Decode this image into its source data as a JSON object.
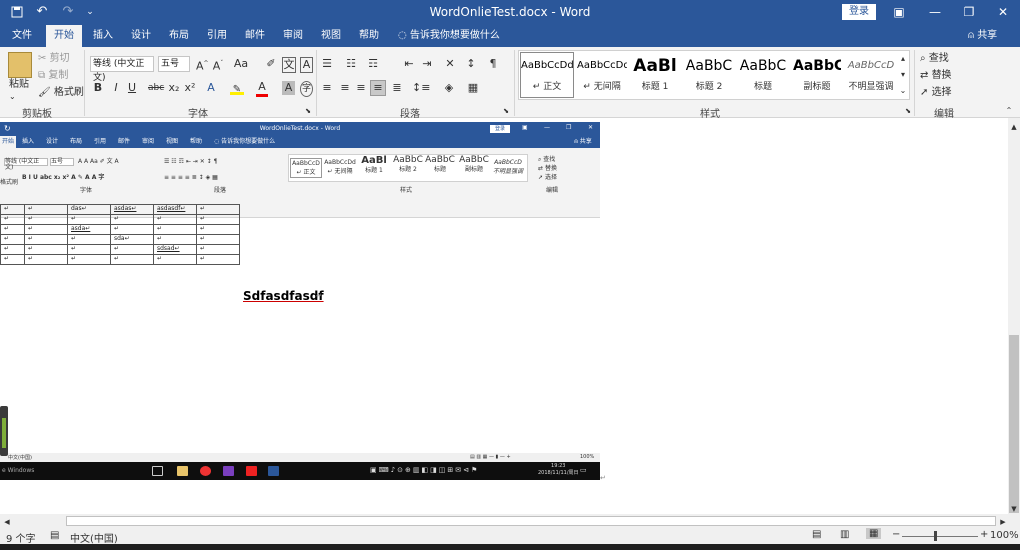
{
  "titlebar": {
    "title": "WordOnlieTest.docx - Word",
    "login": "登录",
    "undo": "↶",
    "redo": "↷",
    "save_icon": "floppy-icon"
  },
  "tabs": [
    "文件",
    "开始",
    "插入",
    "设计",
    "布局",
    "引用",
    "邮件",
    "审阅",
    "视图",
    "帮助"
  ],
  "tell_me": "告诉我你想要做什么",
  "share": "共享",
  "clipboard": {
    "paste": "粘贴",
    "cut": "剪切",
    "copy": "复制",
    "format_painter": "格式刷",
    "group": "剪贴板"
  },
  "font": {
    "name": "等线 (中文正文)",
    "size": "五号",
    "group": "字体"
  },
  "paragraph": {
    "group": "段落"
  },
  "styles": {
    "group": "样式",
    "items": [
      {
        "preview": "AaBbCcDd",
        "label": "↵ 正文"
      },
      {
        "preview": "AaBbCcDd",
        "label": "↵ 无间隔"
      },
      {
        "preview": "AaBl",
        "label": "标题 1"
      },
      {
        "preview": "AaBbC",
        "label": "标题 2"
      },
      {
        "preview": "AaBbC",
        "label": "标题"
      },
      {
        "preview": "AaBbC",
        "label": "副标题"
      },
      {
        "preview": "AaBbCcD",
        "label": "不明显强调"
      }
    ]
  },
  "editing": {
    "find": "查找",
    "replace": "替换",
    "select": "选择",
    "group": "编辑"
  },
  "document": {
    "heading": "Sdfasdfasdf",
    "embedded": {
      "title": "WordOnlieTest.docx - Word",
      "login": "登录",
      "tell_me": "告诉我你想要做什么",
      "share": "共享",
      "tabs": [
        "开始",
        "插入",
        "设计",
        "布局",
        "引用",
        "邮件",
        "审阅",
        "视图",
        "帮助"
      ],
      "font_name": "等线 (中文正文)",
      "font_size": "五号",
      "style_previews": [
        "AaBbCcD",
        "AaBbCcDd",
        "AaBl",
        "AaBbC",
        "AaBbC",
        "AaBbC",
        "AaBbCcD"
      ],
      "style_labels": [
        "↵ 正文",
        "↵ 无间隔",
        "标题 1",
        "标题 2",
        "标题",
        "副标题",
        "不明显强调"
      ],
      "groups": [
        "格式刷",
        "字体",
        "段落",
        "样式",
        "编辑"
      ],
      "editing": [
        "查找",
        "替换",
        "选择"
      ],
      "table": [
        [
          "↵",
          "↵",
          "das↵",
          "asdas↵",
          "asdasdf↵",
          "↵"
        ],
        [
          "↵",
          "↵",
          "↵",
          "↵",
          "↵",
          "↵"
        ],
        [
          "↵",
          "↵",
          "asda↵",
          "↵",
          "↵",
          "↵"
        ],
        [
          "↵",
          "↵",
          "↵",
          "sda↵",
          "↵",
          "↵"
        ],
        [
          "↵",
          "↵",
          "↵",
          "↵",
          "sdsad↵",
          "↵"
        ],
        [
          "↵",
          "↵",
          "↵",
          "↵",
          "↵",
          "↵"
        ]
      ],
      "status_lang": "中文(中国)",
      "zoom": "100%",
      "taskbar_left": "e Windows",
      "clock_time": "19:23",
      "clock_date": "2018/11/11/周日"
    }
  },
  "statusbar": {
    "word_count": "9 个字",
    "language": "中文(中国)",
    "zoom": "100%",
    "zoom_minus": "−",
    "zoom_plus": "+"
  }
}
